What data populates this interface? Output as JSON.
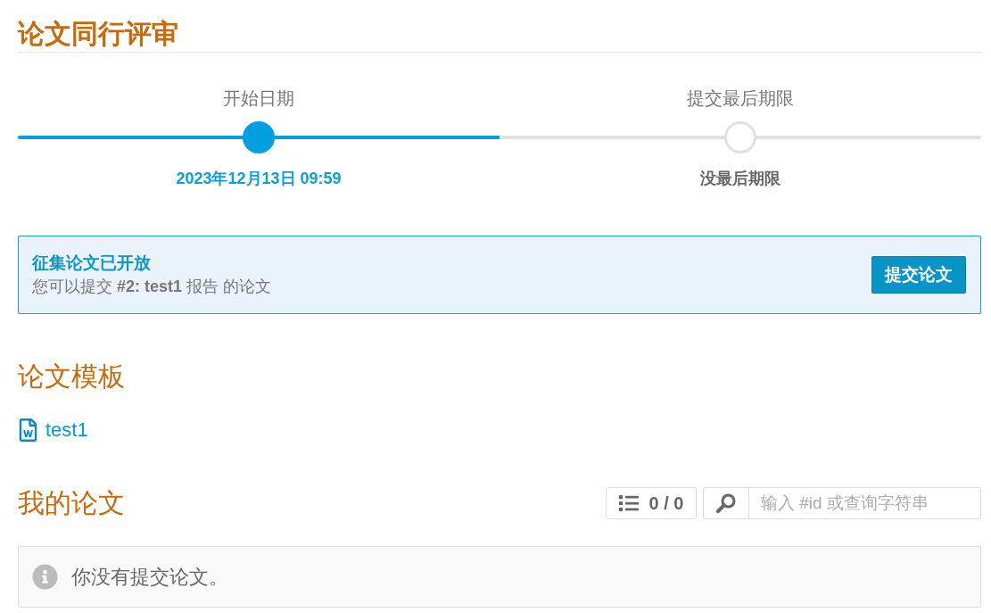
{
  "page_title": "论文同行评审",
  "timeline": [
    {
      "label": "开始日期",
      "date": "2023年12月13日 09:59",
      "reached": true
    },
    {
      "label": "提交最后期限",
      "date": "没最后期限",
      "reached": false
    }
  ],
  "notice": {
    "title": "征集论文已开放",
    "message": "您可以提交 **#2: test1** 报告 的论文",
    "button": "提交论文"
  },
  "templates": {
    "heading": "论文模板",
    "files": [
      {
        "name": "test1"
      }
    ]
  },
  "my_papers": {
    "heading": "我的论文",
    "counter": "0 / 0",
    "search": {
      "placeholder": "输入 #id 或查询字符串"
    },
    "empty_message": "你没有提交论文。"
  }
}
